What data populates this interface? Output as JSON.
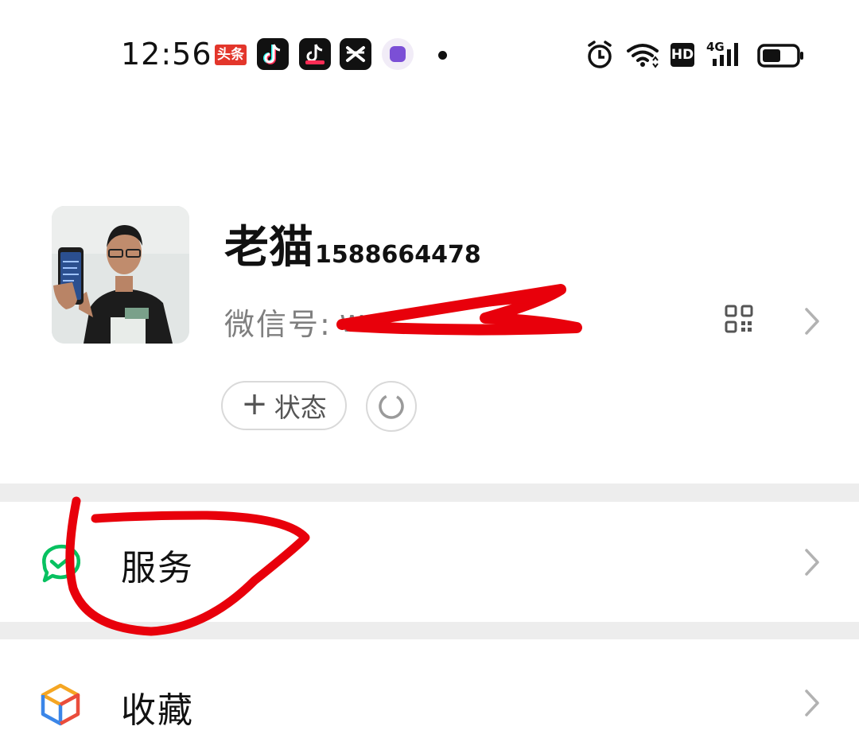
{
  "status_bar": {
    "time": "12:56",
    "app_icons": [
      "toutiao-icon",
      "douyin-icon",
      "douyin-lite-icon",
      "capcut-icon",
      "purple-app-icon"
    ],
    "toutiao_label": "头条",
    "indicators": [
      "alarm-icon",
      "wifi-icon",
      "hd-icon",
      "signal-4g-icon",
      "battery-icon"
    ],
    "hd_label": "HD",
    "network_label": "4G"
  },
  "profile": {
    "nickname": "老猫",
    "nickname_suffix": "1588664478",
    "wechat_id_label": "微信号:",
    "wechat_id_value": "w",
    "status_button_label": "状态"
  },
  "menu": {
    "items": [
      {
        "label": "服务",
        "icon": "wechat-pay-icon"
      },
      {
        "label": "收藏",
        "icon": "favorites-cube-icon"
      }
    ]
  },
  "colors": {
    "accent_green": "#07c160",
    "annotation_red": "#e8000b",
    "separator": "#ededed"
  }
}
